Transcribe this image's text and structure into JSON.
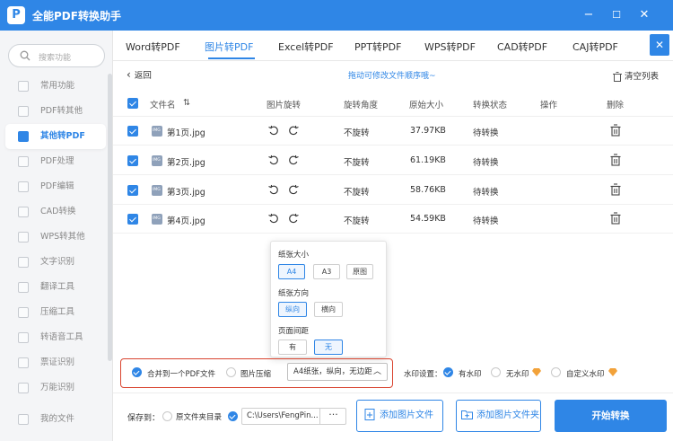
{
  "app": {
    "title": "全能PDF转换助手",
    "logo_letter": "P",
    "minimize": "−",
    "restore": "☐",
    "close": "✕"
  },
  "sidebar": {
    "search_placeholder": "搜索功能",
    "items": [
      {
        "label": "常用功能"
      },
      {
        "label": "PDF转其他"
      },
      {
        "label": "其他转PDF",
        "active": true
      },
      {
        "label": "PDF处理"
      },
      {
        "label": "PDF编辑"
      },
      {
        "label": "CAD转换"
      },
      {
        "label": "WPS转其他"
      },
      {
        "label": "文字识别"
      },
      {
        "label": "翻译工具"
      },
      {
        "label": "压缩工具"
      },
      {
        "label": "转语音工具"
      },
      {
        "label": "票证识别"
      },
      {
        "label": "万能识别"
      },
      {
        "label": "我的文件"
      }
    ]
  },
  "tabs": [
    "Word转PDF",
    "图片转PDF",
    "Excel转PDF",
    "PPT转PDF",
    "WPS转PDF",
    "CAD转PDF",
    "CAJ转PDF"
  ],
  "tabs_close": "✕",
  "toolbar": {
    "back": "返回",
    "back_arrow": "‹",
    "hint": "拖动可修改文件顺序哦~",
    "clear": "清空列表"
  },
  "table": {
    "headers": {
      "name": "文件名",
      "sort": "⇅",
      "rotate": "图片旋转",
      "angle": "旋转角度",
      "size": "原始大小",
      "status": "转换状态",
      "action": "操作",
      "delete": "删除"
    },
    "rows": [
      {
        "name": "第1页.jpg",
        "angle": "不旋转",
        "size": "37.97KB",
        "status": "待转换"
      },
      {
        "name": "第2页.jpg",
        "angle": "不旋转",
        "size": "61.19KB",
        "status": "待转换"
      },
      {
        "name": "第3页.jpg",
        "angle": "不旋转",
        "size": "58.76KB",
        "status": "待转换"
      },
      {
        "name": "第4页.jpg",
        "angle": "不旋转",
        "size": "54.59KB",
        "status": "待转换"
      }
    ]
  },
  "popup": {
    "paper_size": "纸张大小",
    "size_options": [
      "A4",
      "A3",
      "原图"
    ],
    "orientation": "纸张方向",
    "orientation_options": [
      "纵向",
      "横向"
    ],
    "margin": "页面间距",
    "margin_options": [
      "有",
      "无"
    ]
  },
  "options": {
    "merge": "合并到一个PDF文件",
    "compress": "图片压缩",
    "select_value": "A4纸张，纵向，无边距",
    "select_chevron": "︿",
    "watermark_label": "水印设置：",
    "wm_options": [
      "有水印",
      "无水印",
      "自定义水印"
    ]
  },
  "save": {
    "label": "保存到：",
    "source_dir": "原文件夹目录",
    "path": "C:\\Users\\FengPin...",
    "browse": "···"
  },
  "buttons": {
    "add_image": "添加图片文件",
    "add_folder": "添加图片文件夹",
    "start": "开始转换"
  },
  "colors": {
    "accent": "#2f86e6",
    "highlight_box": "#d9442f",
    "premium": "#f2a23a"
  }
}
